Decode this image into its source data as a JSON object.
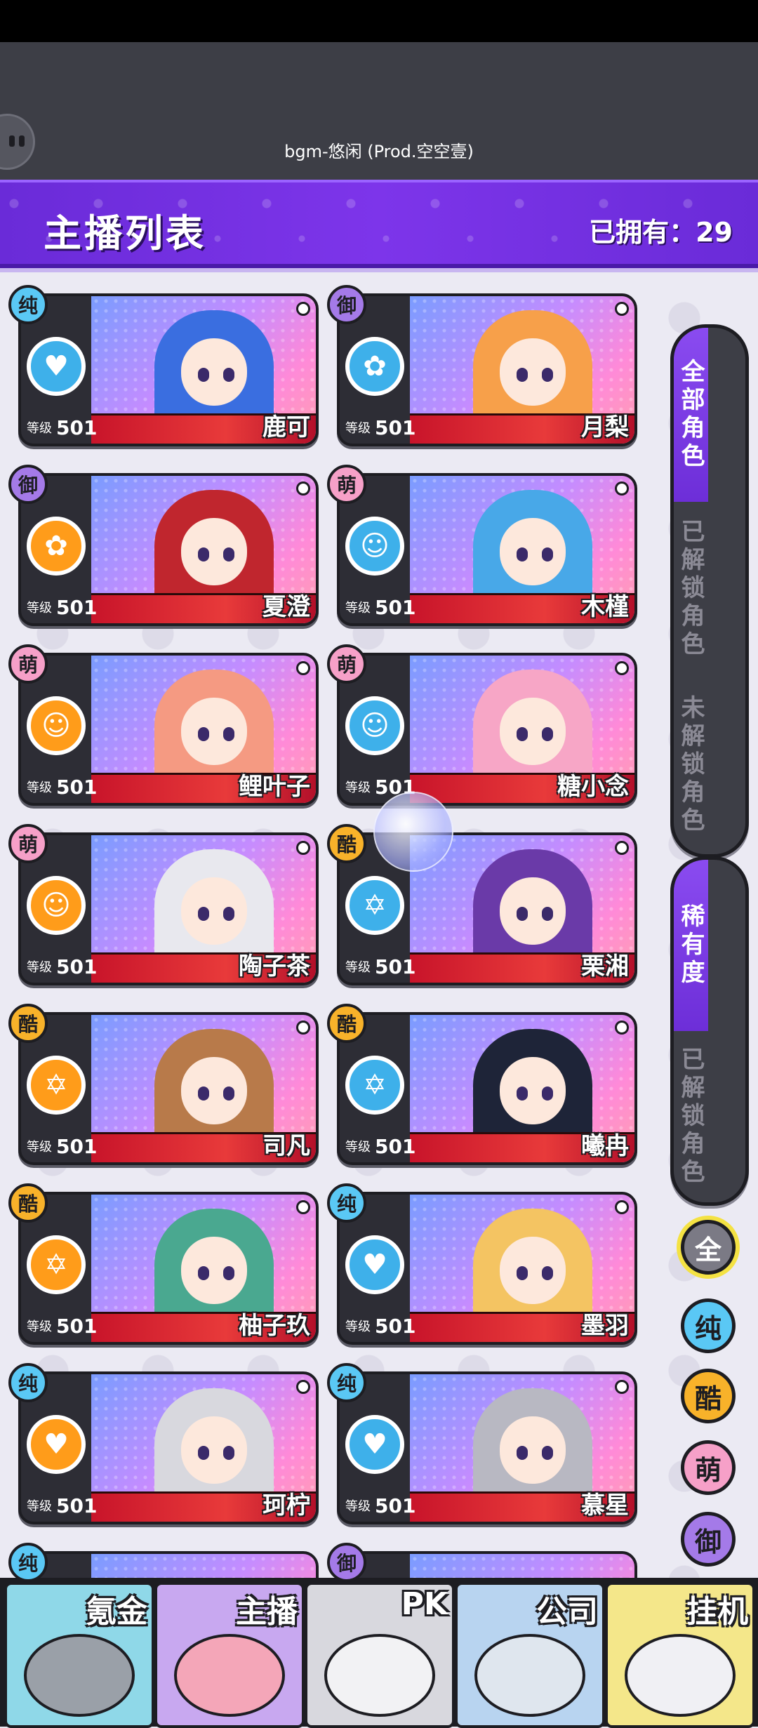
{
  "bgm_text": "bgm-悠闲 (Prod.空空壹)",
  "header": {
    "title": "主播列表",
    "owned": "已拥有：29"
  },
  "cards": [
    {
      "type": "纯",
      "type_class": "b-chun",
      "ring": "blue",
      "ring_icon": "heartbeat-icon",
      "glyph": "♥",
      "level_label": "等级",
      "level": "501",
      "name": "鹿可",
      "hair": "#3a6ee0"
    },
    {
      "type": "御",
      "type_class": "b-yu",
      "ring": "blue",
      "ring_icon": "rose-icon",
      "glyph": "✿",
      "level_label": "等级",
      "level": "501",
      "name": "月梨",
      "hair": "#f7a04a"
    },
    {
      "type": "御",
      "type_class": "b-yu",
      "ring": "orange",
      "ring_icon": "rose-icon",
      "glyph": "✿",
      "level_label": "等级",
      "level": "501",
      "name": "夏澄",
      "hair": "#c0262e"
    },
    {
      "type": "萌",
      "type_class": "b-meng",
      "ring": "blue",
      "ring_icon": "cat-icon",
      "glyph": "☺",
      "level_label": "等级",
      "level": "501",
      "name": "木槿",
      "hair": "#48a8e8"
    },
    {
      "type": "萌",
      "type_class": "b-meng",
      "ring": "orange",
      "ring_icon": "cat-icon",
      "glyph": "☺",
      "level_label": "等级",
      "level": "501",
      "name": "鲤叶子",
      "hair": "#f59a82"
    },
    {
      "type": "萌",
      "type_class": "b-meng",
      "ring": "blue",
      "ring_icon": "cat-icon",
      "glyph": "☺",
      "level_label": "等级",
      "level": "501",
      "name": "糖小念",
      "hair": "#f7a6c6"
    },
    {
      "type": "萌",
      "type_class": "b-meng",
      "ring": "orange",
      "ring_icon": "cat-icon",
      "glyph": "☺",
      "level_label": "等级",
      "level": "501",
      "name": "陶子茶",
      "hair": "#e8e8ee"
    },
    {
      "type": "酷",
      "type_class": "b-ku",
      "ring": "blue",
      "ring_icon": "star-icon",
      "glyph": "✡",
      "level_label": "等级",
      "level": "501",
      "name": "栗湘",
      "hair": "#6a3aa8"
    },
    {
      "type": "酷",
      "type_class": "b-ku",
      "ring": "orange",
      "ring_icon": "star-icon",
      "glyph": "✡",
      "level_label": "等级",
      "level": "501",
      "name": "司凡",
      "hair": "#b87a4a"
    },
    {
      "type": "酷",
      "type_class": "b-ku",
      "ring": "blue",
      "ring_icon": "star-icon",
      "glyph": "✡",
      "level_label": "等级",
      "level": "501",
      "name": "曦冉",
      "hair": "#1e2438"
    },
    {
      "type": "酷",
      "type_class": "b-ku",
      "ring": "orange",
      "ring_icon": "star-icon",
      "glyph": "✡",
      "level_label": "等级",
      "level": "501",
      "name": "柚子玖",
      "hair": "#4aa890"
    },
    {
      "type": "纯",
      "type_class": "b-chun",
      "ring": "blue",
      "ring_icon": "heartbeat-icon",
      "glyph": "♥",
      "level_label": "等级",
      "level": "501",
      "name": "墨羽",
      "hair": "#f4c462"
    },
    {
      "type": "纯",
      "type_class": "b-chun",
      "ring": "orange",
      "ring_icon": "heartbeat-icon",
      "glyph": "♥",
      "level_label": "等级",
      "level": "501",
      "name": "珂柠",
      "hair": "#d8d8de"
    },
    {
      "type": "纯",
      "type_class": "b-chun",
      "ring": "blue",
      "ring_icon": "heartbeat-icon",
      "glyph": "♥",
      "level_label": "等级",
      "level": "501",
      "name": "慕星",
      "hair": "#b8b8c2"
    }
  ],
  "partial_badges": [
    {
      "type": "纯",
      "type_class": "b-chun"
    },
    {
      "type": "御",
      "type_class": "b-yu"
    }
  ],
  "side_tabs": {
    "group1": [
      {
        "label": "全部角色",
        "active": true
      },
      {
        "label": "已解锁角色",
        "active": false
      },
      {
        "label": "未解锁角色",
        "active": false
      }
    ],
    "group2": [
      {
        "label": "稀有度",
        "active": true
      },
      {
        "label": "已解锁角色",
        "active": false
      }
    ]
  },
  "filters": [
    {
      "label": "全",
      "cls": "f-all"
    },
    {
      "label": "纯",
      "cls": "f-chun"
    },
    {
      "label": "酷",
      "cls": "f-ku"
    },
    {
      "label": "萌",
      "cls": "f-meng"
    },
    {
      "label": "御",
      "cls": "f-yu"
    }
  ],
  "bottom_nav": [
    {
      "label": "氪金",
      "bg": "#8fd8e8",
      "ill": "#9aa0a8"
    },
    {
      "label": "主播",
      "bg": "#c8a8f0",
      "ill": "#f4a6b8"
    },
    {
      "label": "PK",
      "bg": "#d8d8de",
      "ill": "#f2f2f4"
    },
    {
      "label": "公司",
      "bg": "#b8d4f0",
      "ill": "#dfe6ee"
    },
    {
      "label": "挂机",
      "bg": "#f4e78a",
      "ill": "#f0f0f4"
    }
  ]
}
